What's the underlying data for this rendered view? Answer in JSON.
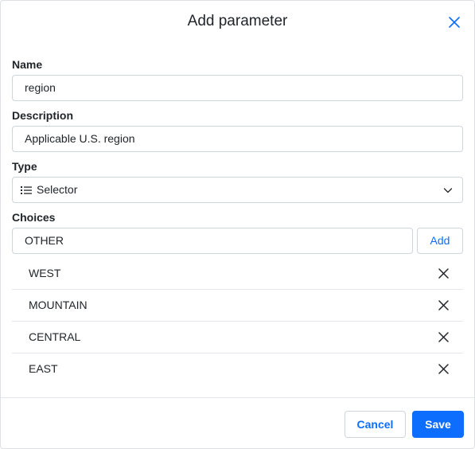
{
  "dialog": {
    "title": "Add parameter"
  },
  "fields": {
    "name_label": "Name",
    "name_value": "region",
    "description_label": "Description",
    "description_value": "Applicable U.S. region",
    "type_label": "Type",
    "type_value": "Selector",
    "choices_label": "Choices",
    "choices_input_value": "OTHER",
    "add_label": "Add"
  },
  "choices": [
    "WEST",
    "MOUNTAIN",
    "CENTRAL",
    "EAST"
  ],
  "footer": {
    "cancel_label": "Cancel",
    "save_label": "Save"
  },
  "icons": {
    "close": "close-icon",
    "type": "list-icon",
    "dropdown": "chevron-down-icon",
    "remove": "remove-icon"
  },
  "colors": {
    "accent": "#0d6efd",
    "border": "#ced4da",
    "text": "#212529"
  }
}
